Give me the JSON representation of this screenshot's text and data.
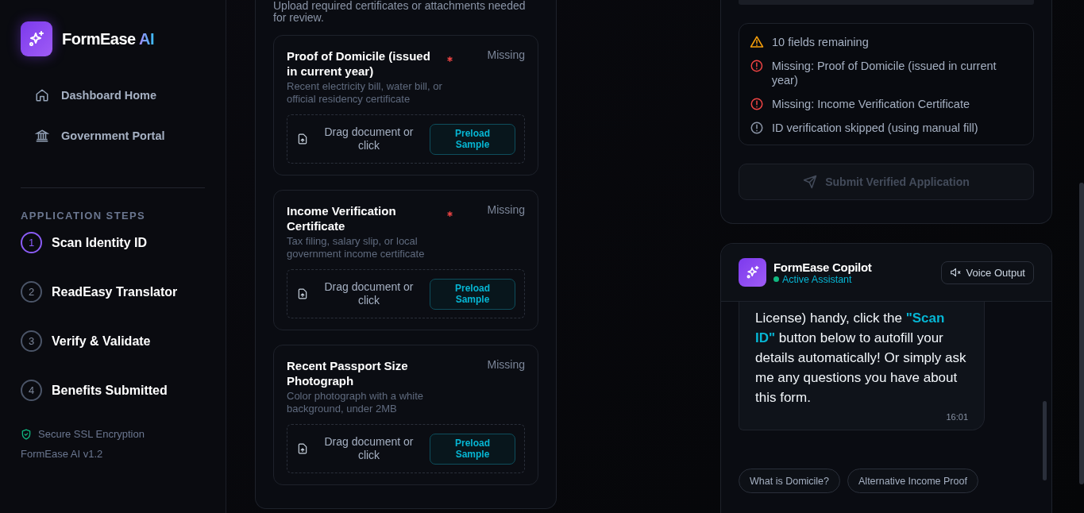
{
  "sidebar": {
    "brand": {
      "name": "FormEase",
      "accent": "AI"
    },
    "nav": [
      {
        "label": "Dashboard Home",
        "kind": "home"
      },
      {
        "label": "Government Portal",
        "kind": "portal"
      }
    ],
    "section_title": "APPLICATION STEPS",
    "steps": [
      {
        "number": "1",
        "label": "Scan Identity ID",
        "selected": true
      },
      {
        "number": "2",
        "label": "ReadEasy Translator",
        "selected": false
      },
      {
        "number": "3",
        "label": "Verify & Validate",
        "selected": false
      },
      {
        "number": "4",
        "label": "Benefits Submitted",
        "selected": false
      }
    ],
    "security": "Secure SSL Encryption",
    "version": "FormEase AI v1.2"
  },
  "documents": {
    "description": "Upload required certificates or attachments needed for review.",
    "items": [
      {
        "title": "Proof of Domicile (issued in current year)",
        "required": true,
        "status": "Missing",
        "hint": "Recent electricity bill, water bill, or official residency certificate",
        "drop_text": "Drag document or click",
        "button": "Preload Sample"
      },
      {
        "title": "Income Verification Certificate",
        "required": true,
        "status": "Missing",
        "hint": "Tax filing, salary slip, or local government income certificate",
        "drop_text": "Drag document or click",
        "button": "Preload Sample"
      },
      {
        "title": "Recent Passport Size Photograph",
        "required": false,
        "status": "Missing",
        "hint": "Color photograph with a white background, under 2MB",
        "drop_text": "Drag document or click",
        "button": "Preload Sample"
      }
    ]
  },
  "validation": {
    "items": [
      {
        "kind": "warning",
        "text": "10 fields remaining"
      },
      {
        "kind": "error",
        "text": "Missing: Proof of Domicile (issued in current year)"
      },
      {
        "kind": "error",
        "text": "Missing: Income Verification Certificate"
      },
      {
        "kind": "info",
        "text": "ID verification skipped (using manual fill)"
      }
    ],
    "submit": {
      "label": "Submit Verified Application",
      "disabled": true
    }
  },
  "copilot": {
    "title": "FormEase Copilot",
    "status": "Active Assistant",
    "voice_button": "Voice Output",
    "message": {
      "text": "License) handy, click the **\"Scan ID\"** button below to autofill your details automatically! Or simply ask me any questions you have about this form.",
      "time": "16:01"
    },
    "chips": [
      "What is Domicile?",
      "Alternative Income Proof"
    ]
  }
}
